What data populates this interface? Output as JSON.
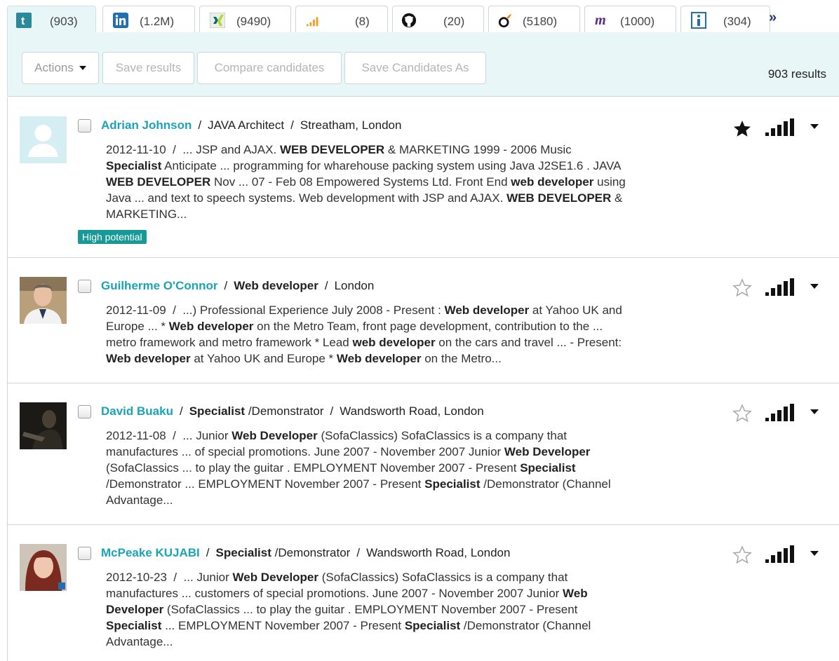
{
  "tabs": [
    {
      "icon": "tumblr-icon",
      "count": "(903)",
      "active": true
    },
    {
      "icon": "linkedin-icon",
      "count": "(1.2M)"
    },
    {
      "icon": "xing-icon",
      "count": "(9490)"
    },
    {
      "icon": "stackoverflow-icon",
      "count": "(8)"
    },
    {
      "icon": "github-icon",
      "count": "(20)"
    },
    {
      "icon": "viadeo-icon",
      "count": "(5180)"
    },
    {
      "icon": "meetup-icon",
      "count": "(1000)"
    },
    {
      "icon": "info-icon",
      "count": "(304)"
    }
  ],
  "more_tabs": "»",
  "toolbar": {
    "actions_label": "Actions",
    "save_results_label": "Save results",
    "compare_label": "Compare candidates",
    "save_as_label": "Save Candidates As",
    "results_text": "903 results"
  },
  "candidates": [
    {
      "name": "Adrian Johnson",
      "title_bold": "",
      "title_rest": "JAVA Architect",
      "location": "Streatham, London",
      "date": "2012-11-10",
      "snippet_lines": [
        [
          [
            "... JSP and AJAX. ",
            false
          ],
          [
            "WEB DEVELOPER",
            true
          ],
          [
            " & MARKETING 1999 - 2006 Music",
            false
          ]
        ],
        [
          [
            "Specialist",
            true
          ],
          [
            " Anticipate ... programming for wharehouse packing system using Java J2SE1.6 . JAVA",
            false
          ]
        ],
        [
          [
            "WEB DEVELOPER",
            true
          ],
          [
            " Nov ... 07 - Feb 08 Empowered Systems Ltd. Front End ",
            false
          ],
          [
            "web developer",
            true
          ],
          [
            " using",
            false
          ]
        ],
        [
          [
            "Java ... and text to speech systems. Web development with JSP and AJAX. ",
            false
          ],
          [
            "WEB DEVELOPER",
            true
          ],
          [
            " &",
            false
          ]
        ],
        [
          [
            "MARKETING...",
            false
          ]
        ]
      ],
      "badge": "High potential",
      "starred": true,
      "avatar": "placeholder"
    },
    {
      "name": "Guilherme O'Connor",
      "title_bold": "Web developer",
      "title_rest": "",
      "location": "London",
      "date": "2012-11-09",
      "snippet_lines": [
        [
          [
            "...) Professional Experience July 2008 - Present : ",
            false
          ],
          [
            "Web developer",
            true
          ],
          [
            " at Yahoo UK and",
            false
          ]
        ],
        [
          [
            "Europe ... * ",
            false
          ],
          [
            "Web developer",
            true
          ],
          [
            " on the Metro Team, front page development, contribution to the ...",
            false
          ]
        ],
        [
          [
            "metro framework and metro framework * Lead ",
            false
          ],
          [
            "web developer",
            true
          ],
          [
            " on the cars and travel ... - Present:",
            false
          ]
        ],
        [
          [
            "Web developer",
            true
          ],
          [
            " at Yahoo UK and Europe * ",
            false
          ],
          [
            "Web developer",
            true
          ],
          [
            " on the Metro...",
            false
          ]
        ]
      ],
      "badge": "",
      "starred": false,
      "avatar": "man-suit"
    },
    {
      "name": "David Buaku",
      "title_bold": "Specialist",
      "title_rest": " /Demonstrator",
      "location": "Wandsworth Road, London",
      "date": "2012-11-08",
      "snippet_lines": [
        [
          [
            "... Junior ",
            false
          ],
          [
            "Web Developer",
            true
          ],
          [
            " (SofaClassics) SofaClassics is a company that",
            false
          ]
        ],
        [
          [
            "manufactures ... of special promotions. June 2007 - November 2007 Junior ",
            false
          ],
          [
            "Web Developer",
            true
          ]
        ],
        [
          [
            "(SofaClassics ... to play the guitar . EMPLOYMENT November 2007 - Present ",
            false
          ],
          [
            "Specialist",
            true
          ]
        ],
        [
          [
            "/Demonstrator ... EMPLOYMENT November 2007 - Present ",
            false
          ],
          [
            "Specialist",
            true
          ],
          [
            " /Demonstrator (Channel",
            false
          ]
        ],
        [
          [
            "Advantage...",
            false
          ]
        ]
      ],
      "badge": "",
      "starred": false,
      "avatar": "dark-photo"
    },
    {
      "name": "McPeake KUJABI",
      "title_bold": "Specialist",
      "title_rest": " /Demonstrator",
      "location": "Wandsworth Road, London",
      "date": "2012-10-23",
      "snippet_lines": [
        [
          [
            "... Junior ",
            false
          ],
          [
            "Web Developer",
            true
          ],
          [
            " (SofaClassics) SofaClassics is a company that",
            false
          ]
        ],
        [
          [
            "manufactures ... customers of special promotions. June 2007 - November 2007 Junior ",
            false
          ],
          [
            "Web",
            true
          ]
        ],
        [
          [
            "Developer",
            true
          ],
          [
            " (SofaClassics ... to play the guitar . EMPLOYMENT November 2007 - Present",
            false
          ]
        ],
        [
          [
            "Specialist",
            true
          ],
          [
            " ... EMPLOYMENT November 2007 - Present ",
            false
          ],
          [
            "Specialist",
            true
          ],
          [
            " /Demonstrator (Channel",
            false
          ]
        ],
        [
          [
            "Advantage...",
            false
          ]
        ]
      ],
      "badge": "",
      "starred": false,
      "avatar": "woman-photo"
    }
  ],
  "colors": {
    "accent": "#1ba3b8",
    "toolbar_bg": "#e8f6f8",
    "badge": "#179a97"
  }
}
